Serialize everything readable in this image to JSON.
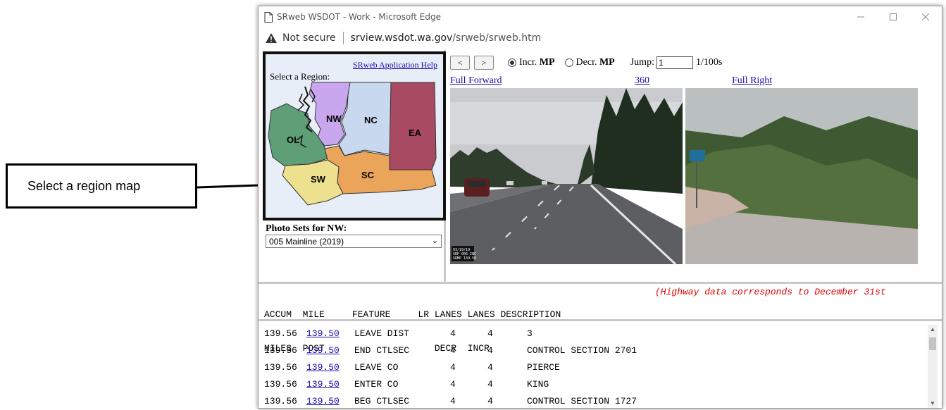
{
  "callout": {
    "text": "Select a region map"
  },
  "window": {
    "title": "SRweb WSDOT - Work - Microsoft Edge",
    "security_text": "Not secure",
    "url_host": "srview.wsdot.wa.gov",
    "url_path": "/srweb/srweb.htm",
    "controls": [
      "minimize",
      "maximize",
      "close"
    ]
  },
  "region_panel": {
    "help_link": "SRweb Application Help",
    "label": "Select a Region:",
    "regions": [
      "OL",
      "NW",
      "NC",
      "EA",
      "SW",
      "SC"
    ],
    "region_colors": {
      "OL": "#5f9f78",
      "NW": "#c9a7ee",
      "NC": "#c8d8ee",
      "EA": "#a84a62",
      "SW": "#ede08e",
      "SC": "#eaa55a"
    }
  },
  "photo_sets": {
    "label": "Photo Sets for NW:",
    "selected": "005 Mainline (2019)"
  },
  "nav": {
    "prev": "<",
    "next": ">",
    "incr_label": "Incr.",
    "decr_label": "Decr.",
    "mp": "MP",
    "incr_selected": true,
    "jump_label": "Jump:",
    "jump_value": "1",
    "jump_unit": "1/100s"
  },
  "views": {
    "full_forward": "Full Forward",
    "three_sixty": "360",
    "full_right": "Full Right"
  },
  "photo_stamp": [
    "03/19/19",
    "SRP 005-INC",
    "SRMP 139.50"
  ],
  "table": {
    "headers": {
      "line1": "ACCUM  MILE     FEATURE     LR LANES LANES DESCRIPTION",
      "line2": "MILES  POST                    DECR  INCR",
      "note": "(Highway data corresponds to December 31st"
    },
    "rows": [
      {
        "accum": "139.56",
        "mp": "139.50",
        "feature": "LEAVE DIST",
        "decr": "4",
        "incr": "4",
        "desc": "3"
      },
      {
        "accum": "139.56",
        "mp": "139.50",
        "feature": "END CTLSEC",
        "decr": "4",
        "incr": "4",
        "desc": "CONTROL SECTION 2701"
      },
      {
        "accum": "139.56",
        "mp": "139.50",
        "feature": "LEAVE CO",
        "decr": "4",
        "incr": "4",
        "desc": "PIERCE"
      },
      {
        "accum": "139.56",
        "mp": "139.50",
        "feature": "ENTER CO",
        "decr": "4",
        "incr": "4",
        "desc": "KING"
      },
      {
        "accum": "139.56",
        "mp": "139.50",
        "feature": "BEG CTLSEC",
        "decr": "4",
        "incr": "4",
        "desc": "CONTROL SECTION 1727"
      }
    ]
  }
}
